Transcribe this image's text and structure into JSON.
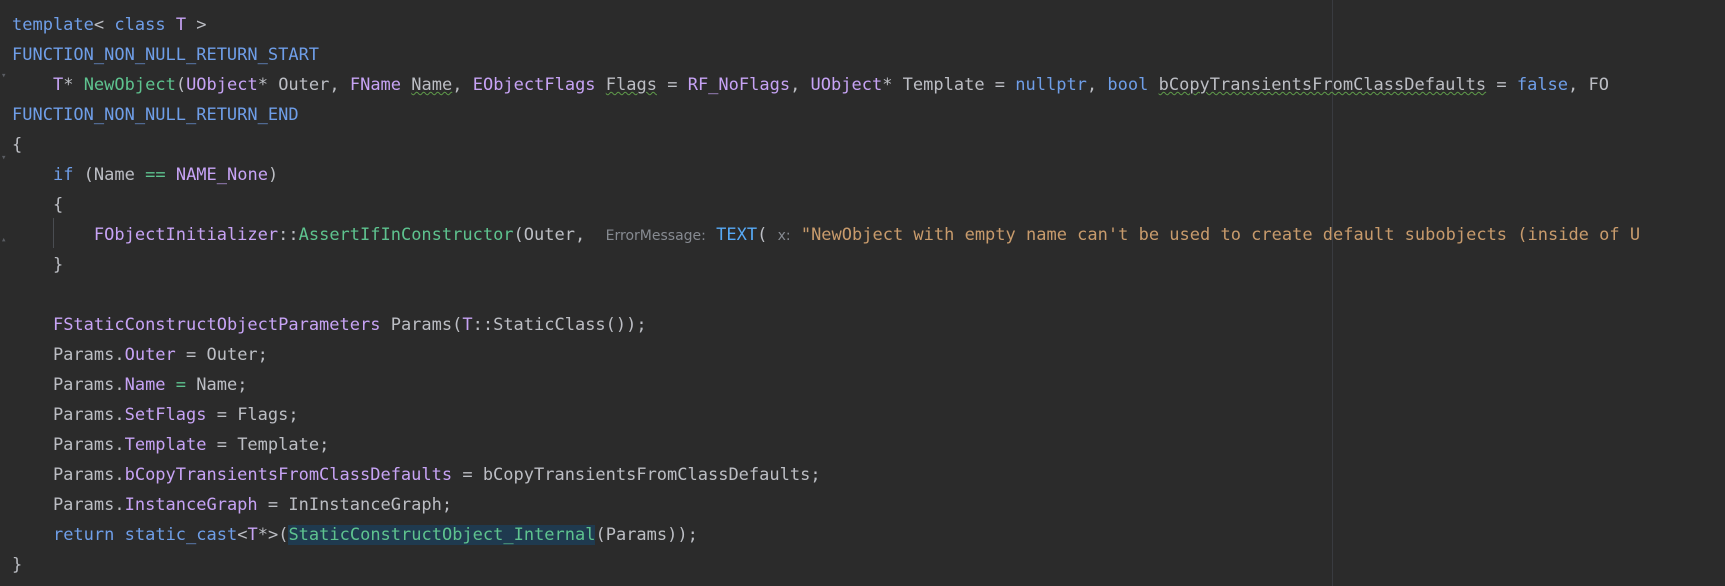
{
  "code_lines": [
    {
      "segments": [
        [
          "kw",
          "template"
        ],
        [
          "pl",
          "< "
        ],
        [
          "kw",
          "class"
        ],
        [
          "pl",
          " "
        ],
        [
          "ty",
          "T"
        ],
        [
          "pl",
          " >"
        ]
      ]
    },
    {
      "segments": [
        [
          "mc",
          "FUNCTION_NON_NULL_RETURN_START"
        ]
      ]
    },
    {
      "segments": [
        [
          "pl",
          "    "
        ],
        [
          "ty",
          "T"
        ],
        [
          "pl",
          "* "
        ],
        [
          "fn2",
          "NewObject"
        ],
        [
          "pl",
          "("
        ],
        [
          "ty",
          "UObject"
        ],
        [
          "pl",
          "* Outer, "
        ],
        [
          "ty",
          "FName"
        ],
        [
          "pl",
          " "
        ],
        [
          "u",
          "Name"
        ],
        [
          "pl",
          ", "
        ],
        [
          "ty",
          "EObjectFlags"
        ],
        [
          "pl",
          " "
        ],
        [
          "u",
          "Flags"
        ],
        [
          "pl",
          " = "
        ],
        [
          "ty",
          "RF_NoFlags"
        ],
        [
          "pl",
          ", "
        ],
        [
          "ty",
          "UObject"
        ],
        [
          "pl",
          "* Template = "
        ],
        [
          "kw",
          "nullptr"
        ],
        [
          "pl",
          ", "
        ],
        [
          "kw",
          "bool"
        ],
        [
          "pl",
          " "
        ],
        [
          "u",
          "bCopyTransientsFromClassDefaults"
        ],
        [
          "pl",
          " = "
        ],
        [
          "kw",
          "false"
        ],
        [
          "pl",
          ", FO"
        ]
      ]
    },
    {
      "segments": [
        [
          "mc",
          "FUNCTION_NON_NULL_RETURN_END"
        ]
      ]
    },
    {
      "segments": [
        [
          "pl",
          "{"
        ]
      ]
    },
    {
      "segments": [
        [
          "pl",
          "    "
        ],
        [
          "kw",
          "if"
        ],
        [
          "pl",
          " (Name "
        ],
        [
          "op",
          "=="
        ],
        [
          "pl",
          " "
        ],
        [
          "ty",
          "NAME_None"
        ],
        [
          "pl",
          ")"
        ]
      ]
    },
    {
      "segments": [
        [
          "pl",
          "    {"
        ]
      ]
    },
    {
      "segments": [
        [
          "pl",
          "        "
        ],
        [
          "ty",
          "FObjectInitializer"
        ],
        [
          "pl",
          "::"
        ],
        [
          "fn2",
          "AssertIfInConstructor"
        ],
        [
          "pl",
          "(Outer,  "
        ],
        [
          "hint",
          "ErrorMessage:"
        ],
        [
          "pl",
          " "
        ],
        [
          "fn",
          "TEXT"
        ],
        [
          "pl",
          "( "
        ],
        [
          "hint",
          "x:"
        ],
        [
          "pl",
          " "
        ],
        [
          "str",
          "\"NewObject with empty name can't be used to create default subobjects (inside of U"
        ]
      ]
    },
    {
      "segments": [
        [
          "pl",
          "    }"
        ]
      ]
    },
    {
      "segments": [
        [
          "pl",
          ""
        ]
      ]
    },
    {
      "segments": [
        [
          "pl",
          "    "
        ],
        [
          "ty",
          "FStaticConstructObjectParameters"
        ],
        [
          "pl",
          " Params("
        ],
        [
          "ty",
          "T"
        ],
        [
          "pl",
          "::StaticClass());"
        ]
      ]
    },
    {
      "segments": [
        [
          "pl",
          "    Params."
        ],
        [
          "fld",
          "Outer"
        ],
        [
          "pl",
          " = Outer;"
        ]
      ]
    },
    {
      "segments": [
        [
          "pl",
          "    Params."
        ],
        [
          "fld",
          "Name"
        ],
        [
          "pl",
          " "
        ],
        [
          "op",
          "="
        ],
        [
          "pl",
          " Name;"
        ]
      ]
    },
    {
      "segments": [
        [
          "pl",
          "    Params."
        ],
        [
          "fld",
          "SetFlags"
        ],
        [
          "pl",
          " = Flags;"
        ]
      ]
    },
    {
      "segments": [
        [
          "pl",
          "    Params."
        ],
        [
          "fld",
          "Template"
        ],
        [
          "pl",
          " = Template;"
        ]
      ]
    },
    {
      "segments": [
        [
          "pl",
          "    Params."
        ],
        [
          "fld",
          "bCopyTransientsFromClassDefaults"
        ],
        [
          "pl",
          " = bCopyTransientsFromClassDefaults;"
        ]
      ]
    },
    {
      "segments": [
        [
          "pl",
          "    Params."
        ],
        [
          "fld",
          "InstanceGraph"
        ],
        [
          "pl",
          " = InInstanceGraph;"
        ]
      ]
    },
    {
      "segments": [
        [
          "pl",
          "    "
        ],
        [
          "kw",
          "return"
        ],
        [
          "pl",
          " "
        ],
        [
          "kw",
          "static_cast"
        ],
        [
          "pl",
          "<"
        ],
        [
          "ty",
          "T"
        ],
        [
          "pl",
          "*>("
        ],
        [
          "hlfn",
          "StaticConstructObject_Internal"
        ],
        [
          "pl",
          "(Params));"
        ]
      ]
    },
    {
      "segments": [
        [
          "pl",
          "}"
        ]
      ]
    }
  ]
}
